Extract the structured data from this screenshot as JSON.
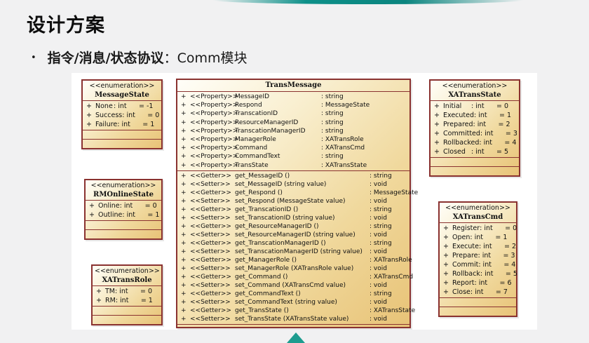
{
  "slide": {
    "title": "设计方案",
    "bullet": {
      "marker": "•",
      "bold_text": "指令/消息/状态协议",
      "regular_text": "：Comm模块"
    }
  },
  "colors": {
    "accent_teal": "#1E9C8F",
    "box_border_maroon": "#8A3230",
    "box_fill_light": "#FFFEF8",
    "box_fill_dark": "#E8C377",
    "slide_background": "#F1F1F2",
    "panel_background": "#FFFFFF"
  },
  "icons": {
    "nav_triangle_icon": "triangle-up"
  },
  "diagram": {
    "enums": [
      {
        "stereotype": "<<enumeration>>",
        "name": "MessageState",
        "attrs": [
          {
            "vis": "+",
            "name": "None",
            "type": ": int",
            "value": "= -1"
          },
          {
            "vis": "+",
            "name": "Success",
            "type": ": int",
            "value": "= 0"
          },
          {
            "vis": "+",
            "name": "Failure",
            "type": ": int",
            "value": "= 1"
          }
        ]
      },
      {
        "stereotype": "<<enumeration>>",
        "name": "RMOnlineState",
        "attrs": [
          {
            "vis": "+",
            "name": "Online",
            "type": ": int",
            "value": "= 0"
          },
          {
            "vis": "+",
            "name": "Outline",
            "type": ": int",
            "value": "= 1"
          }
        ]
      },
      {
        "stereotype": "<<enumeration>>",
        "name": "XATransRole",
        "attrs": [
          {
            "vis": "+",
            "name": "TM",
            "type": ": int",
            "value": "= 0"
          },
          {
            "vis": "+",
            "name": "RM",
            "type": ": int",
            "value": "= 1"
          }
        ]
      },
      {
        "stereotype": "<<enumeration>>",
        "name": "XATransState",
        "attrs": [
          {
            "vis": "+",
            "name": "Initial",
            "type": ": int",
            "value": "= 0"
          },
          {
            "vis": "+",
            "name": "Executed",
            "type": ": int",
            "value": "= 1"
          },
          {
            "vis": "+",
            "name": "Prepared",
            "type": ": int",
            "value": "= 2"
          },
          {
            "vis": "+",
            "name": "Committed",
            "type": ": int",
            "value": "= 3"
          },
          {
            "vis": "+",
            "name": "Rollbacked",
            "type": ": int",
            "value": "= 4"
          },
          {
            "vis": "+",
            "name": "Closed",
            "type": ": int",
            "value": "= 5"
          }
        ]
      },
      {
        "stereotype": "<<enumeration>>",
        "name": "XATransCmd",
        "attrs": [
          {
            "vis": "+",
            "name": "Register",
            "type": ": int",
            "value": "= 0"
          },
          {
            "vis": "+",
            "name": "Open",
            "type": ": int",
            "value": "= 1"
          },
          {
            "vis": "+",
            "name": "Execute",
            "type": ": int",
            "value": "= 2"
          },
          {
            "vis": "+",
            "name": "Prepare",
            "type": ": int",
            "value": "= 3"
          },
          {
            "vis": "+",
            "name": "Commit",
            "type": ": int",
            "value": "= 4"
          },
          {
            "vis": "+",
            "name": "Rollback",
            "type": ": int",
            "value": "= 5"
          },
          {
            "vis": "+",
            "name": "Report",
            "type": ": int",
            "value": "= 6"
          },
          {
            "vis": "+",
            "name": "Close",
            "type": ": int",
            "value": "= 7"
          }
        ]
      }
    ],
    "trans_message": {
      "name": "TransMessage",
      "properties": [
        {
          "vis": "+",
          "stereotype": "<<Property>>",
          "name": "MessageID",
          "type": ": string"
        },
        {
          "vis": "+",
          "stereotype": "<<Property>>",
          "name": "Respond",
          "type": ": MessageState"
        },
        {
          "vis": "+",
          "stereotype": "<<Property>>",
          "name": "TranscationID",
          "type": ": string"
        },
        {
          "vis": "+",
          "stereotype": "<<Property>>",
          "name": "ResourceManagerID",
          "type": ": string"
        },
        {
          "vis": "+",
          "stereotype": "<<Property>>",
          "name": "TranscationManagerID",
          "type": ": string"
        },
        {
          "vis": "+",
          "stereotype": "<<Property>>",
          "name": "ManagerRole",
          "type": ": XATransRole"
        },
        {
          "vis": "+",
          "stereotype": "<<Property>>",
          "name": "Command",
          "type": ": XATransCmd"
        },
        {
          "vis": "+",
          "stereotype": "<<Property>>",
          "name": "CommandText",
          "type": ": string"
        },
        {
          "vis": "+",
          "stereotype": "<<Property>>",
          "name": "TransState",
          "type": ": XATransState"
        }
      ],
      "methods": [
        {
          "vis": "+",
          "stereotype": "<<Getter>>",
          "signature": "get_MessageID ()",
          "type": ": string"
        },
        {
          "vis": "+",
          "stereotype": "<<Setter>>",
          "signature": "set_MessageID (string value)",
          "type": ": void"
        },
        {
          "vis": "+",
          "stereotype": "<<Getter>>",
          "signature": "get_Respond ()",
          "type": ": MessageState"
        },
        {
          "vis": "+",
          "stereotype": "<<Setter>>",
          "signature": "set_Respond (MessageState value)",
          "type": ": void"
        },
        {
          "vis": "+",
          "stereotype": "<<Getter>>",
          "signature": "get_TranscationID ()",
          "type": ": string"
        },
        {
          "vis": "+",
          "stereotype": "<<Setter>>",
          "signature": "set_TranscationID (string value)",
          "type": ": void"
        },
        {
          "vis": "+",
          "stereotype": "<<Getter>>",
          "signature": "get_ResourceManagerID ()",
          "type": ": string"
        },
        {
          "vis": "+",
          "stereotype": "<<Setter>>",
          "signature": "set_ResourceManagerID (string value)",
          "type": ": void"
        },
        {
          "vis": "+",
          "stereotype": "<<Getter>>",
          "signature": "get_TranscationManagerID ()",
          "type": ": string"
        },
        {
          "vis": "+",
          "stereotype": "<<Setter>>",
          "signature": "set_TranscationManagerID (string value)",
          "type": ": void"
        },
        {
          "vis": "+",
          "stereotype": "<<Getter>>",
          "signature": "get_ManagerRole ()",
          "type": ": XATransRole"
        },
        {
          "vis": "+",
          "stereotype": "<<Setter>>",
          "signature": "set_ManagerRole (XATransRole value)",
          "type": ": void"
        },
        {
          "vis": "+",
          "stereotype": "<<Getter>>",
          "signature": "get_Command ()",
          "type": ": XATransCmd"
        },
        {
          "vis": "+",
          "stereotype": "<<Setter>>",
          "signature": "set_Command (XATransCmd value)",
          "type": ": void"
        },
        {
          "vis": "+",
          "stereotype": "<<Getter>>",
          "signature": "get_CommandText ()",
          "type": ": string"
        },
        {
          "vis": "+",
          "stereotype": "<<Setter>>",
          "signature": "set_CommandText (string value)",
          "type": ": void"
        },
        {
          "vis": "+",
          "stereotype": "<<Getter>>",
          "signature": "get_TransState ()",
          "type": ": XATransState"
        },
        {
          "vis": "+",
          "stereotype": "<<Setter>>",
          "signature": "set_TransState (XATransState value)",
          "type": ": void"
        }
      ]
    }
  }
}
